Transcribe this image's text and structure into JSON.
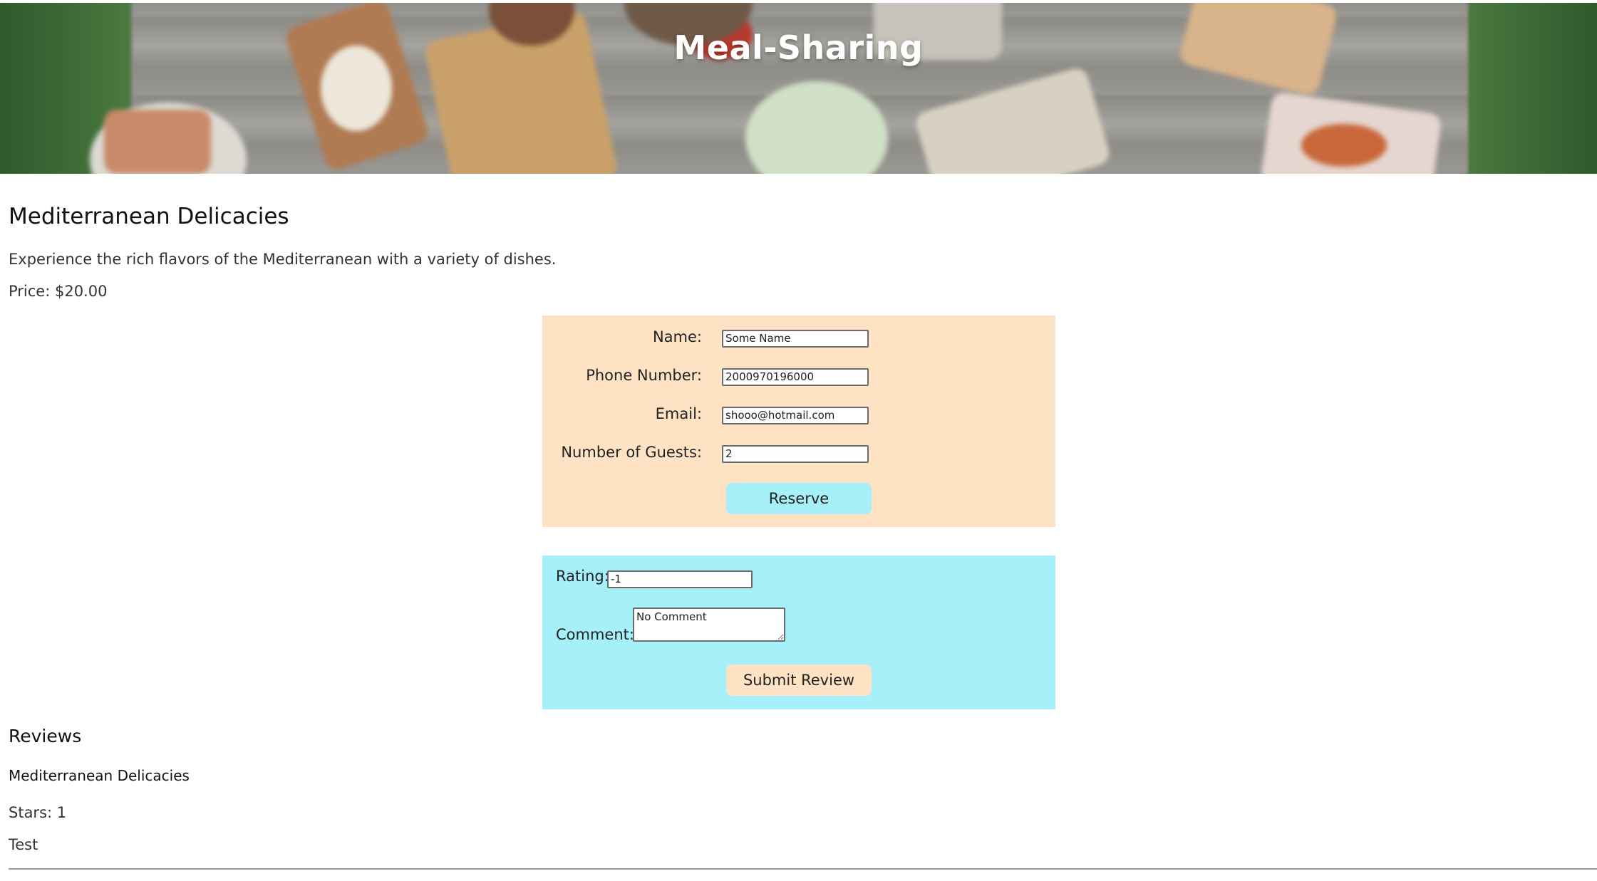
{
  "header": {
    "title": "Meal-Sharing"
  },
  "meal": {
    "title": "Mediterranean Delicacies",
    "description": "Experience the rich flavors of the Mediterranean with a variety of dishes.",
    "price_text": "Price: $20.00"
  },
  "reservation_form": {
    "name_label": "Name:",
    "name_value": "Some Name",
    "phone_label": "Phone Number:",
    "phone_value": "2000970196000",
    "email_label": "Email:",
    "email_value": "shooo@hotmail.com",
    "guests_label": "Number of Guests:",
    "guests_value": "2",
    "submit_label": "Reserve",
    "background_color": "#fde3c3",
    "button_color": "#a6eff9"
  },
  "review_form": {
    "rating_label": "Rating:",
    "rating_value": "-1",
    "comment_label": "Comment:",
    "comment_value": "No Comment",
    "submit_label": "Submit Review",
    "background_color": "#a6f0f9",
    "button_color": "#fde3c3"
  },
  "reviews": {
    "heading": "Reviews",
    "items": [
      {
        "title": "Mediterranean Delicacies",
        "stars_text": "Stars: 1",
        "comment": "Test"
      }
    ]
  }
}
